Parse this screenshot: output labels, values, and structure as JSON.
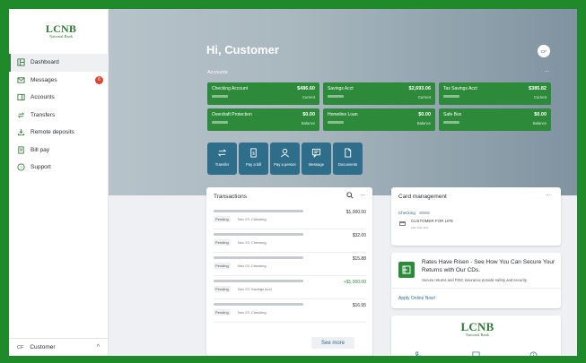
{
  "brand": {
    "name": "LCNB",
    "tagline": "National Bank"
  },
  "sidebar": {
    "items": [
      {
        "label": "Dashboard",
        "icon": "dashboard-icon",
        "active": true
      },
      {
        "label": "Messages",
        "icon": "mail-icon",
        "badge": "6"
      },
      {
        "label": "Accounts",
        "icon": "accounts-icon"
      },
      {
        "label": "Transfers",
        "icon": "transfer-icon"
      },
      {
        "label": "Remote deposits",
        "icon": "deposit-icon"
      },
      {
        "label": "Bill pay",
        "icon": "bill-icon"
      },
      {
        "label": "Support",
        "icon": "help-icon"
      }
    ],
    "user": {
      "initials": "CF",
      "name": "Customer",
      "chevron": "^"
    }
  },
  "header": {
    "greeting": "Hi, Customer",
    "avatar_initials": "CF"
  },
  "accounts": {
    "label": "Accounts",
    "more": "...",
    "cards": [
      {
        "name": "Checking Account",
        "balance": "$486.60",
        "sub": "Current"
      },
      {
        "name": "Savings Acct",
        "balance": "$2,693.06",
        "sub": "Current"
      },
      {
        "name": "Tax Savings Acct",
        "balance": "$385.82",
        "sub": "Current"
      },
      {
        "name": "Overdraft Protection",
        "balance": "$0.00",
        "sub": "Balance"
      },
      {
        "name": "Homeline Loan",
        "balance": "$0.00",
        "sub": "Balance"
      },
      {
        "name": "Safe Box",
        "balance": "$0.00",
        "sub": "Balance"
      }
    ]
  },
  "actions": [
    {
      "label": "Transfer",
      "icon": "transfer-icon"
    },
    {
      "label": "Pay a bill",
      "icon": "bill-icon"
    },
    {
      "label": "Pay a person",
      "icon": "person-icon"
    },
    {
      "label": "Message",
      "icon": "message-icon"
    },
    {
      "label": "Documents",
      "icon": "document-icon"
    }
  ],
  "transactions": {
    "title": "Transactions",
    "more": "...",
    "see_more": "See more",
    "rows": [
      {
        "status": "Pending",
        "meta": "Nov 23, Checking",
        "amount": "$1,000.00",
        "credit": false
      },
      {
        "status": "Pending",
        "meta": "Nov 23, Checking",
        "amount": "$32.00",
        "credit": false
      },
      {
        "status": "Pending",
        "meta": "Nov 23, Checking",
        "amount": "$15.88",
        "credit": false
      },
      {
        "status": "Pending",
        "meta": "Nov 23, Savings Acct",
        "amount": "+$1,000.00",
        "credit": true
      },
      {
        "status": "Pending",
        "meta": "Nov 23, Checking",
        "amount": "$16.95",
        "credit": false
      }
    ]
  },
  "card_management": {
    "title": "Card management",
    "more": "...",
    "account": "Checking",
    "card_name": "CUSTOMER FOR LIFE",
    "card_number": "•••• •••• ••••"
  },
  "promo": {
    "title": "Rates Have Risen - See How You Can Secure Your Returns with Our CDs.",
    "body": "Secure returns and FDIC insurance provide safety and security.",
    "link": "Apply Online Now!"
  },
  "colors": {
    "accent_green": "#2d8a3a",
    "action_blue": "#2f6e8a",
    "frame_green": "#1f8a2a"
  }
}
